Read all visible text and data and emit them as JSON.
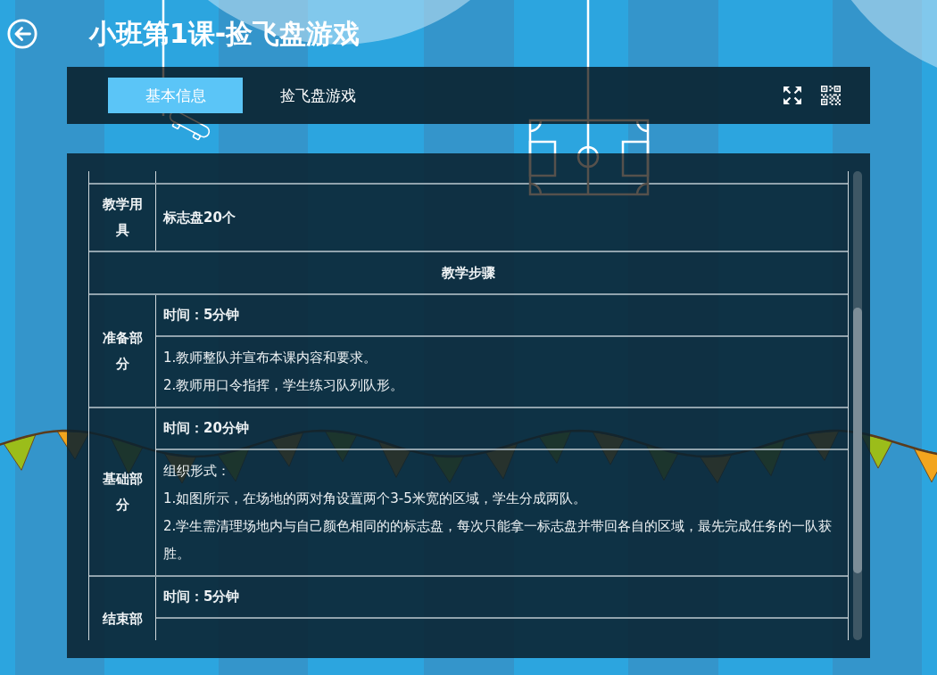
{
  "header": {
    "title": "小班第1课-捡飞盘游戏"
  },
  "tabs": [
    {
      "label": "基本信息",
      "selected": true
    },
    {
      "label": "捡飞盘游戏",
      "selected": false
    }
  ],
  "table": {
    "rows": [
      {
        "kind": "field",
        "label": "教学用具",
        "value": "标志盘20个"
      },
      {
        "kind": "heading",
        "text": "教学步骤"
      },
      {
        "kind": "section",
        "label": "准备部分",
        "time": "时间：5分钟",
        "lines": [
          "1.教师整队并宣布本课内容和要求。",
          "2.教师用口令指挥，学生练习队列队形。"
        ]
      },
      {
        "kind": "section",
        "label": "基础部分",
        "time": "时间：20分钟",
        "lines": [
          "组织形式：",
          "1.如图所示，在场地的两对角设置两个3-5米宽的区域，学生分成两队。",
          "2.学生需清理场地内与自己颜色相同的的标志盘，每次只能拿一标志盘并带回各自的区域，最先完成任务的一队获胜。"
        ]
      },
      {
        "kind": "section",
        "label": "结束部",
        "time": "时间：5分钟"
      }
    ]
  }
}
